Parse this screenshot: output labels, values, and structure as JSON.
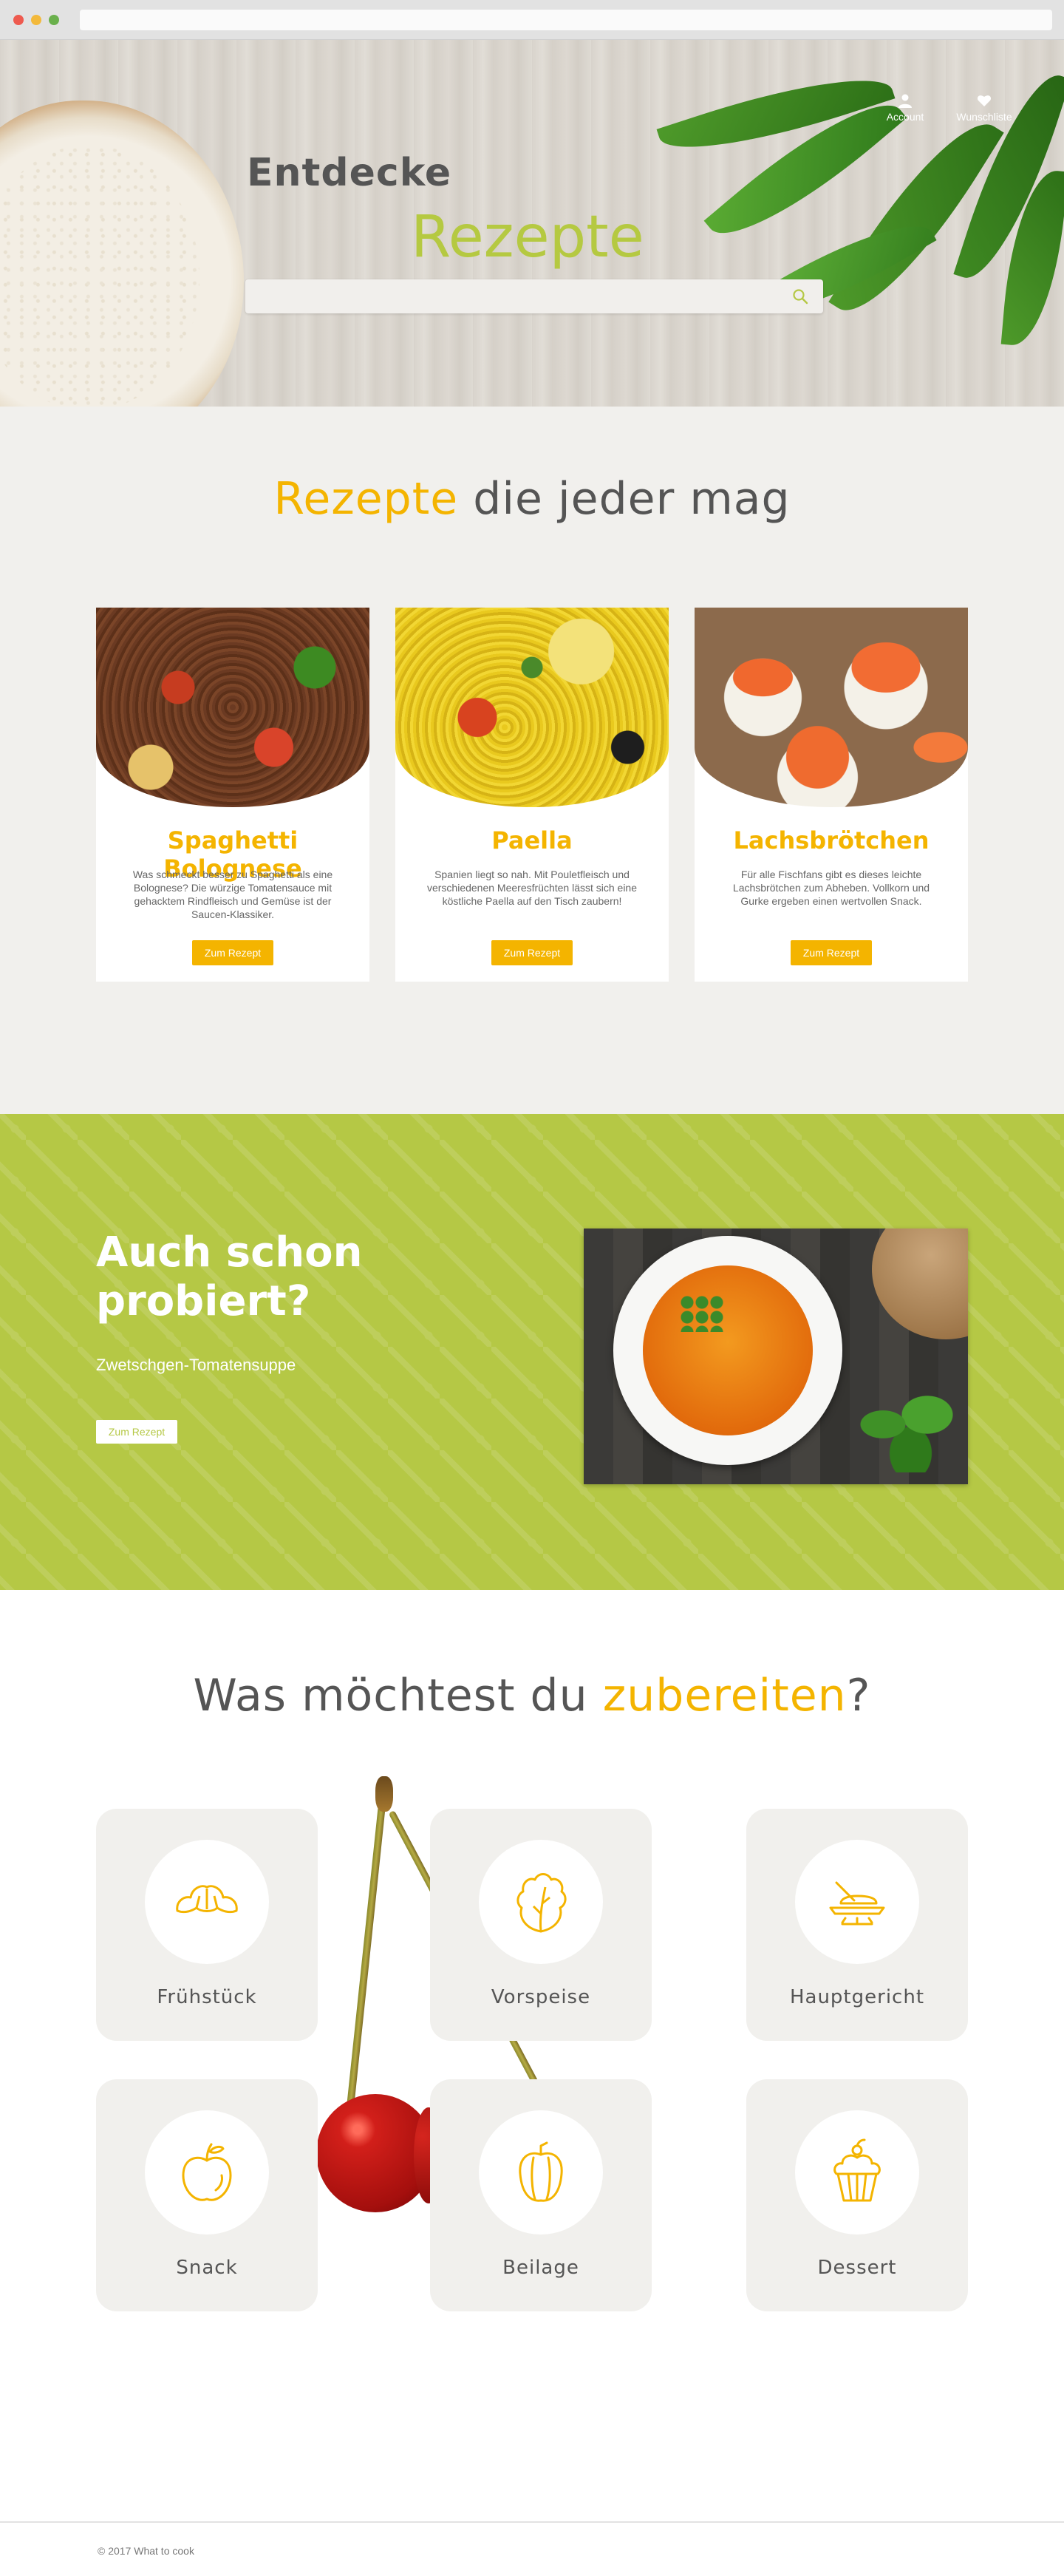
{
  "header": {
    "nav": {
      "account_label": "Account",
      "wishlist_label": "Wunschliste"
    },
    "title_line1": "Entdecke",
    "title_line2": "Rezepte",
    "search": {
      "placeholder": "",
      "value": ""
    }
  },
  "recipes_section": {
    "title_accent": "Rezepte",
    "title_rest": " die jeder mag",
    "cards": [
      {
        "name": "Spaghetti Bolognese",
        "description": "Was schmeckt besser zu Spaghetti als eine Bolognese? Die würzige Tomatensauce mit gehacktem Rindfleisch und Gemüse ist der Saucen-Klassiker.",
        "button_label": "Zum Rezept"
      },
      {
        "name": "Paella",
        "description": "Spanien liegt so nah. Mit Pouletfleisch und verschiedenen Meeresfrüchten lässt sich eine köstliche Paella auf den Tisch zaubern!",
        "button_label": "Zum Rezept"
      },
      {
        "name": "Lachsbrötchen",
        "description": "Für alle Fischfans gibt es dieses leichte Lachsbrötchen zum Abheben. Vollkorn und Gurke ergeben einen wertvollen Snack.",
        "button_label": "Zum Rezept"
      }
    ]
  },
  "tried_section": {
    "title": "Auch schon probiert?",
    "subtitle": "Zwetschgen-Tomatensuppe",
    "button_label": "Zum Rezept"
  },
  "categories_section": {
    "title_start": "Was möchtest du ",
    "title_accent": "zubereiten",
    "title_end": "?",
    "items": [
      {
        "label": "Frühstück",
        "icon": "croissant-icon"
      },
      {
        "label": "Vorspeise",
        "icon": "lettuce-icon"
      },
      {
        "label": "Hauptgericht",
        "icon": "main-dish-icon"
      },
      {
        "label": "Snack",
        "icon": "apple-icon"
      },
      {
        "label": "Beilage",
        "icon": "pepper-icon"
      },
      {
        "label": "Dessert",
        "icon": "cupcake-icon"
      }
    ]
  },
  "footer": {
    "copyright": "© 2017 What to cook"
  },
  "colors": {
    "accent_yellow": "#f4b400",
    "accent_green": "#b5c845",
    "section_bg": "#f1f0ed"
  }
}
